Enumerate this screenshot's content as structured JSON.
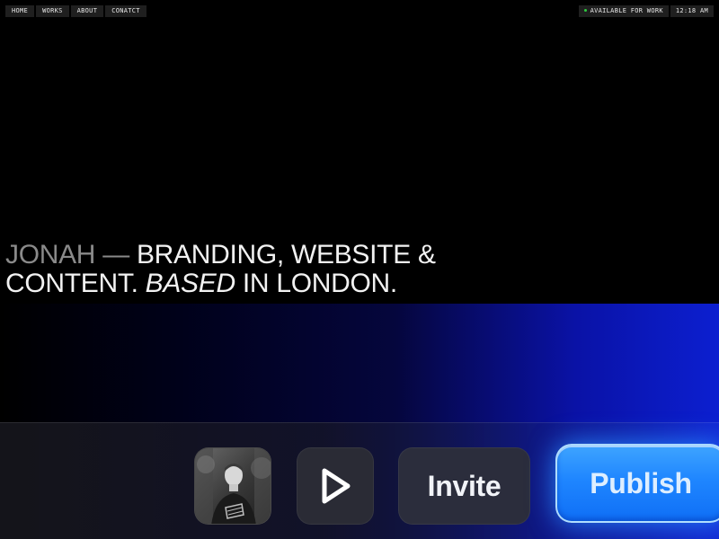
{
  "nav": {
    "items": [
      {
        "label": "HOME"
      },
      {
        "label": "WORKS"
      },
      {
        "label": "ABOUT"
      },
      {
        "label": "CONATCT"
      }
    ]
  },
  "status": {
    "availability": "AVAILABLE FOR WORK",
    "availability_color": "#2ecc40",
    "time": "12:18 AM"
  },
  "headline": {
    "name": "JONAH",
    "dash": " — ",
    "line1_rest": "BRANDING, WEBSITE &",
    "line2_start": "CONTENT. ",
    "line2_italic": "BASED",
    "line2_end": " IN LONDON."
  },
  "dock": {
    "avatar_icon": "profile-photo",
    "play_icon": "play-icon",
    "invite_label": "Invite",
    "publish_label": "Publish",
    "publish_color": "#1f86ff"
  }
}
